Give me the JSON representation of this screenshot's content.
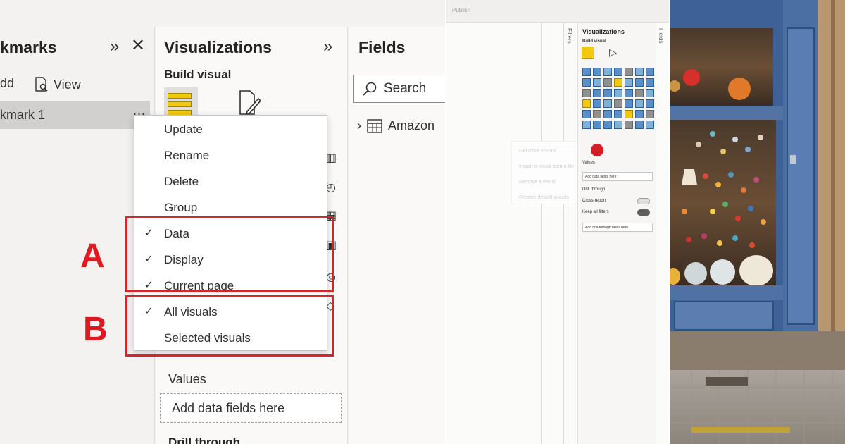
{
  "bookmarks": {
    "title": "kmarks",
    "add_label": "dd",
    "view_label": "View",
    "item_label": "kmark 1",
    "more_label": "..."
  },
  "visualizations": {
    "title": "Visualizations",
    "build_visual": "Build visual",
    "values_label": "Values",
    "add_fields": "Add data fields here",
    "drill_through": "Drill through"
  },
  "fields": {
    "title": "Fields",
    "search_placeholder": "Search",
    "table_name": "Amazon"
  },
  "context_menu": {
    "items": [
      {
        "label": "Update",
        "checked": false
      },
      {
        "label": "Rename",
        "checked": false
      },
      {
        "label": "Delete",
        "checked": false
      },
      {
        "label": "Group",
        "checked": false
      },
      {
        "label": "Data",
        "checked": true
      },
      {
        "label": "Display",
        "checked": true
      },
      {
        "label": "Current page",
        "checked": true
      },
      {
        "label": "All visuals",
        "checked": true
      },
      {
        "label": "Selected visuals",
        "checked": false
      }
    ],
    "check_glyph": "✓"
  },
  "annotations": {
    "a": "A",
    "b": "B",
    "color": "#d6242b"
  },
  "mini_panel": {
    "publish": "Publish",
    "filters": "Filters",
    "fields": "Fields",
    "title": "Visualizations",
    "build_visual": "Build visual",
    "values": "Values",
    "add_fields": "Add data fields here",
    "drill_through": "Drill through",
    "cross_report": "Cross-report",
    "cross_report_toggle": "Off",
    "keep_filters": "Keep all filters",
    "keep_filters_toggle": "On",
    "add_drill": "Add drill-through fields here",
    "faint_menu": [
      "Get more visuals",
      "Import a visual from a file",
      "Remove a visual",
      "Restore default visuals"
    ]
  },
  "colors": {
    "pane_bg": "#f3f2f1",
    "selected_row": "#d2d0ce",
    "accent_yellow": "#f2c811",
    "highlight_red": "#d6242b",
    "window_frame": "#3e6298"
  }
}
